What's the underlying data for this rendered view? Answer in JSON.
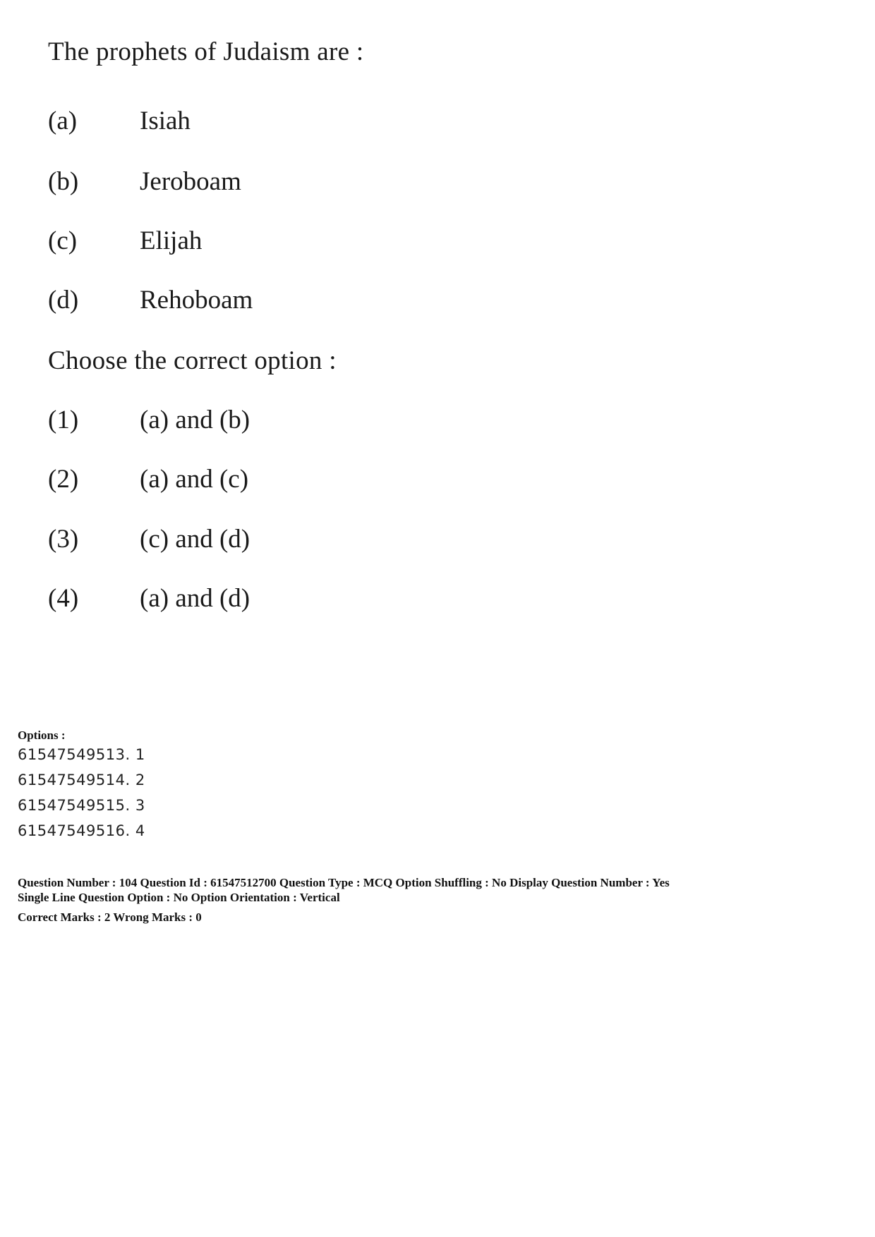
{
  "question": {
    "stem": "The prophets of Judaism are :",
    "items": [
      {
        "label": "(a)",
        "text": "Isiah"
      },
      {
        "label": "(b)",
        "text": "Jeroboam"
      },
      {
        "label": "(c)",
        "text": "Elijah"
      },
      {
        "label": "(d)",
        "text": "Rehoboam"
      }
    ],
    "prompt": "Choose the correct option :",
    "choices": [
      {
        "label": "(1)",
        "text": "(a) and (b)"
      },
      {
        "label": "(2)",
        "text": "(a) and (c)"
      },
      {
        "label": "(3)",
        "text": "(c) and (d)"
      },
      {
        "label": "(4)",
        "text": "(a) and (d)"
      }
    ]
  },
  "options": {
    "heading": "Options :",
    "list": [
      "61547549513. 1",
      "61547549514. 2",
      "61547549515. 3",
      "61547549516. 4"
    ]
  },
  "meta": {
    "line1": "Question Number : 104  Question Id : 61547512700  Question Type : MCQ  Option Shuffling : No  Display Question Number : Yes",
    "line2": "Single Line Question Option : No  Option Orientation : Vertical",
    "line3": "Correct Marks : 2  Wrong Marks : 0"
  }
}
